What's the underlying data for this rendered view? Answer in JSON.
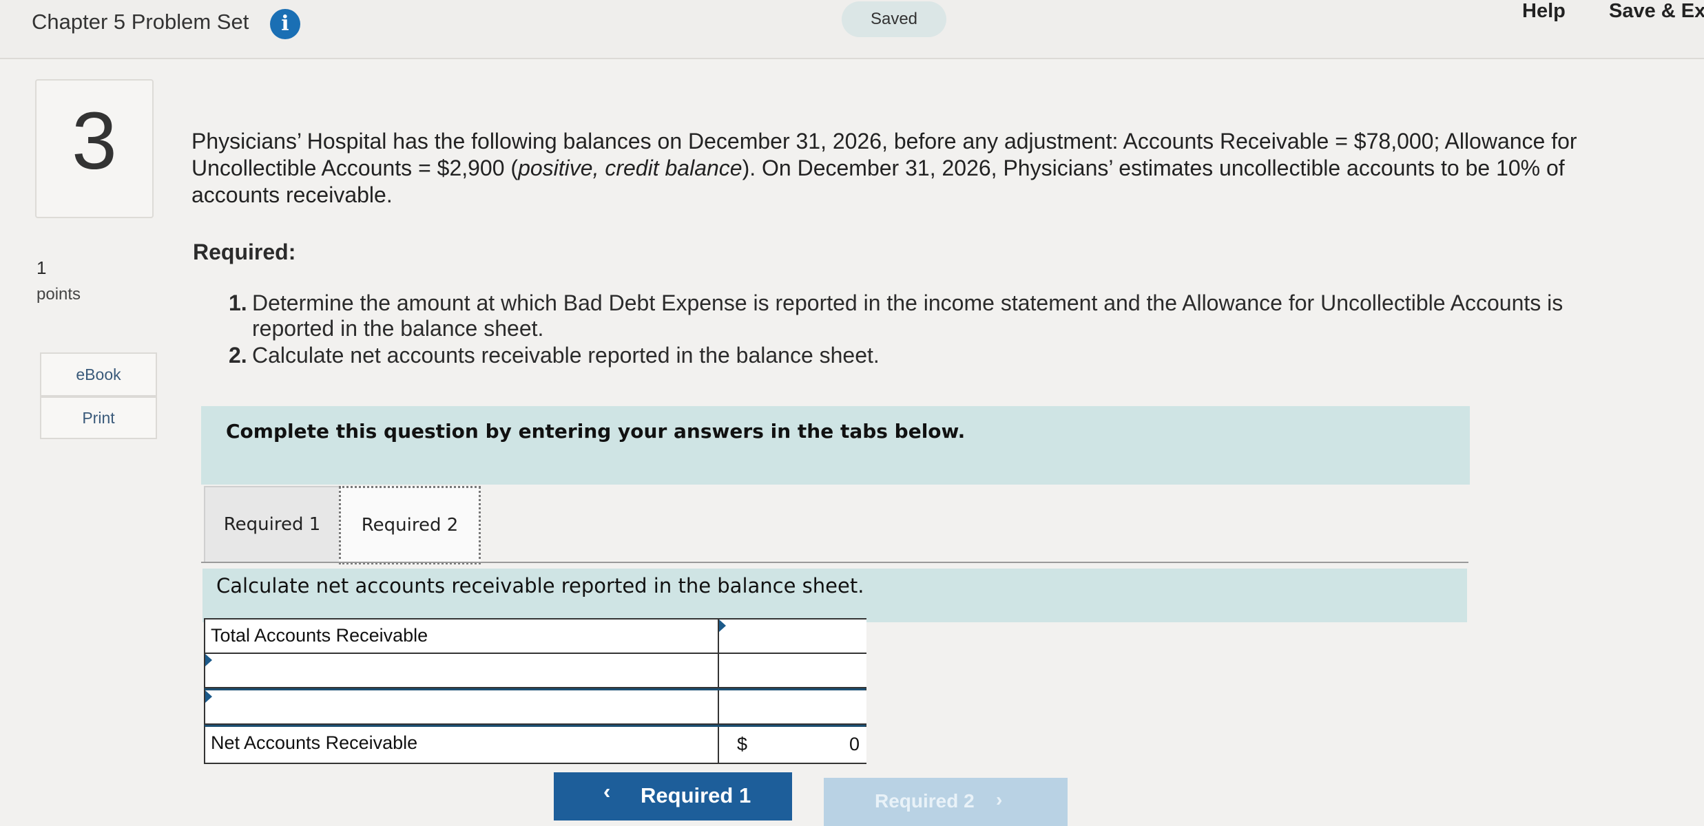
{
  "header": {
    "title": "Chapter 5 Problem Set",
    "info_glyph": "i",
    "saved": "Saved",
    "help": "Help",
    "save_exit": "Save & Exit"
  },
  "question": {
    "number": "3",
    "points_value": "1",
    "points_label": "points",
    "ebook": "eBook",
    "print": "Print",
    "stem": "Physicians’ Hospital has the following balances on December 31, 2026, before any adjustment: Accounts Receivable = $78,000; Allowance for Uncollectible Accounts = $2,900 (positive, credit balance). On December 31, 2026, Physicians’ estimates uncollectible accounts to be 10% of accounts receivable.",
    "required_title": "Required:",
    "requirements": [
      {
        "num": "1.",
        "text": "Determine the amount at which Bad Debt Expense is reported in the income statement and the Allowance for Uncollectible Accounts is reported in the balance sheet."
      },
      {
        "num": "2.",
        "text": "Calculate net accounts receivable reported in the balance sheet."
      }
    ],
    "instruction": "Complete this question by entering your answers in the tabs below."
  },
  "tabs": [
    {
      "label": "Required 1",
      "active": false
    },
    {
      "label": "Required 2",
      "active": true
    }
  ],
  "panel": {
    "prompt": "Calculate net accounts receivable reported in the balance sheet.",
    "rows": [
      {
        "label": "Total Accounts Receivable",
        "dollar": "",
        "value": ""
      },
      {
        "label": "",
        "dollar": "",
        "value": ""
      },
      {
        "label": "",
        "dollar": "",
        "value": ""
      },
      {
        "label": "Net Accounts Receivable",
        "dollar": "$",
        "value": "0"
      }
    ]
  },
  "nav": {
    "prev_label": "Required 1",
    "prev_glyph": "‹",
    "next_label": "Required 2",
    "next_glyph": "›"
  },
  "colors": {
    "accent_blue": "#1d5e9a",
    "instruction_bg": "#cfe4e4",
    "info_icon": "#1a6fb4"
  }
}
